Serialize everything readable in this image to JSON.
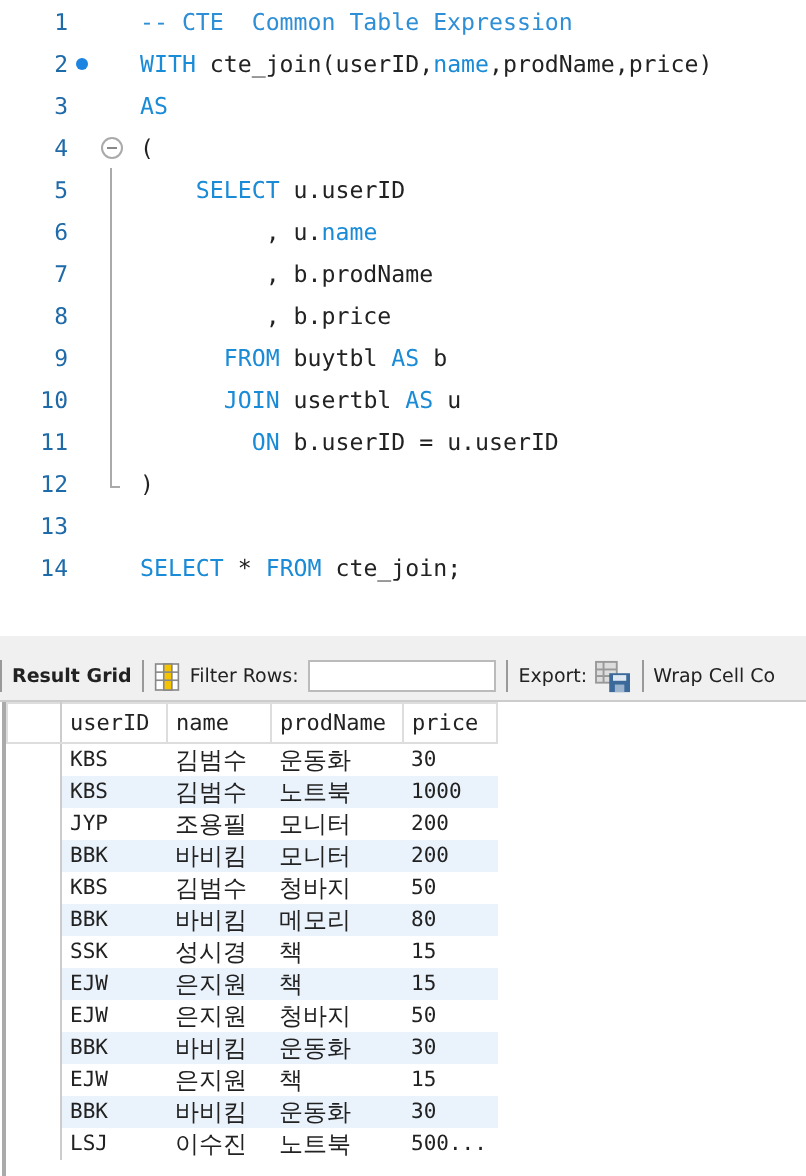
{
  "editor": {
    "lines": [
      {
        "number": "1",
        "tokens": [
          {
            "kind": "comment",
            "text": "-- CTE  Common Table Expression"
          }
        ]
      },
      {
        "number": "2",
        "marker": true,
        "tokens": [
          {
            "kind": "keyword",
            "text": "WITH"
          },
          {
            "kind": "plain",
            "text": " cte_join(userID,"
          },
          {
            "kind": "keyword",
            "text": "name"
          },
          {
            "kind": "plain",
            "text": ",prodName,price)"
          }
        ]
      },
      {
        "number": "3",
        "tokens": [
          {
            "kind": "keyword",
            "text": "AS"
          }
        ]
      },
      {
        "number": "4",
        "expanded": true,
        "tokens": [
          {
            "kind": "plain",
            "text": "("
          }
        ],
        "children": [
          {
            "number": "5",
            "tokens": [
              {
                "kind": "keyword",
                "text": "    SELECT"
              },
              {
                "kind": "plain",
                "text": " u.userID"
              }
            ]
          },
          {
            "number": "6",
            "tokens": [
              {
                "kind": "plain",
                "text": "         , u."
              },
              {
                "kind": "keyword",
                "text": "name"
              }
            ]
          },
          {
            "number": "7",
            "tokens": [
              {
                "kind": "plain",
                "text": "         , b.prodName"
              }
            ]
          },
          {
            "number": "8",
            "tokens": [
              {
                "kind": "plain",
                "text": "         , b.price"
              }
            ]
          },
          {
            "number": "9",
            "tokens": [
              {
                "kind": "keyword",
                "text": "      FROM"
              },
              {
                "kind": "plain",
                "text": " buytbl "
              },
              {
                "kind": "keyword",
                "text": "AS"
              },
              {
                "kind": "plain",
                "text": " b"
              }
            ]
          },
          {
            "number": "10",
            "tokens": [
              {
                "kind": "keyword",
                "text": "      JOIN"
              },
              {
                "kind": "plain",
                "text": " usertbl "
              },
              {
                "kind": "keyword",
                "text": "AS"
              },
              {
                "kind": "plain",
                "text": " u"
              }
            ]
          },
          {
            "number": "11",
            "tokens": [
              {
                "kind": "keyword",
                "text": "        ON"
              },
              {
                "kind": "plain",
                "text": " b.userID = u.userID"
              }
            ]
          },
          {
            "number": "12",
            "tokens": [
              {
                "kind": "plain",
                "text": ")"
              }
            ]
          }
        ]
      },
      {
        "number": "13"
      },
      {
        "number": "14",
        "tokens": [
          {
            "kind": "keyword",
            "text": "SELECT"
          },
          {
            "kind": "plain",
            "text": " * "
          },
          {
            "kind": "keyword",
            "text": "FROM"
          },
          {
            "kind": "plain",
            "text": " cte_join;"
          }
        ]
      }
    ]
  },
  "toolbar": {
    "result_grid": "Result Grid",
    "filter_label": "Filter Rows:",
    "export_label": "Export:",
    "wrap_label": "Wrap Cell Co"
  },
  "table": {
    "columns": [
      "userID",
      "name",
      "prodName",
      "price"
    ],
    "rows": [
      [
        "KBS",
        "김범수",
        "운동화",
        "30"
      ],
      [
        "KBS",
        "김범수",
        "노트북",
        "1000"
      ],
      [
        "JYP",
        "조용필",
        "모니터",
        "200"
      ],
      [
        "BBK",
        "바비킴",
        "모니터",
        "200"
      ],
      [
        "KBS",
        "김범수",
        "청바지",
        "50"
      ],
      [
        "BBK",
        "바비킴",
        "메모리",
        "80"
      ],
      [
        "SSK",
        "성시경",
        "책",
        "15"
      ],
      [
        "EJW",
        "은지원",
        "책",
        "15"
      ],
      [
        "EJW",
        "은지원",
        "청바지",
        "50"
      ],
      [
        "BBK",
        "바비킴",
        "운동화",
        "30"
      ],
      [
        "EJW",
        "은지원",
        "책",
        "15"
      ],
      [
        "BBK",
        "바비킴",
        "운동화",
        "30"
      ],
      [
        "LSJ",
        "이수진",
        "노트북",
        "500..."
      ]
    ]
  }
}
